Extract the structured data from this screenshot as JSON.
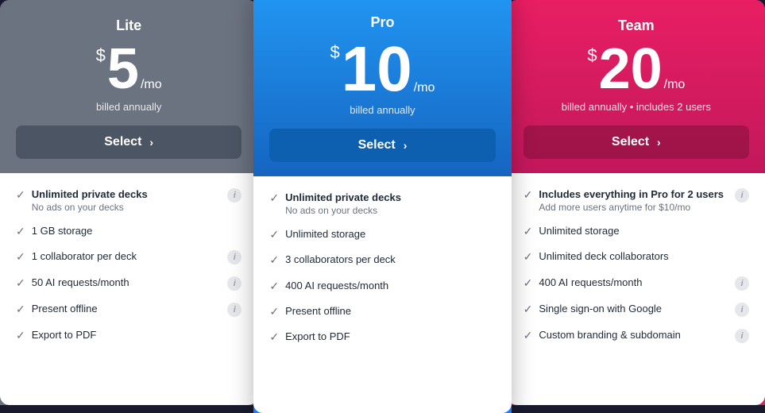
{
  "plans": [
    {
      "id": "lite",
      "name": "Lite",
      "price": "5",
      "period": "/mo",
      "billing": "billed annually",
      "select_label": "Select",
      "features": [
        {
          "text": "Unlimited private decks",
          "sub": "No ads on your decks",
          "bold": true,
          "info": true
        },
        {
          "text": "1 GB storage",
          "bold": false,
          "info": false
        },
        {
          "text": "1 collaborator per deck",
          "bold": false,
          "info": true
        },
        {
          "text": "50 AI requests/month",
          "bold": false,
          "info": true
        },
        {
          "text": "Present offline",
          "bold": false,
          "info": true
        },
        {
          "text": "Export to PDF",
          "bold": false,
          "info": false
        }
      ]
    },
    {
      "id": "pro",
      "name": "Pro",
      "price": "10",
      "period": "/mo",
      "billing": "billed annually",
      "select_label": "Select",
      "features": [
        {
          "text": "Unlimited private decks",
          "sub": "No ads on your decks",
          "bold": true,
          "info": false
        },
        {
          "text": "Unlimited storage",
          "bold": false,
          "info": false
        },
        {
          "text": "3 collaborators per deck",
          "bold": false,
          "info": false
        },
        {
          "text": "400 AI requests/month",
          "bold": false,
          "info": false
        },
        {
          "text": "Present offline",
          "bold": false,
          "info": false
        },
        {
          "text": "Export to PDF",
          "bold": false,
          "info": false
        }
      ]
    },
    {
      "id": "team",
      "name": "Team",
      "price": "20",
      "period": "/mo",
      "billing": "billed annually • includes 2 users",
      "select_label": "Select",
      "features": [
        {
          "text": "Includes everything in Pro for 2 users",
          "sub": "Add more users anytime for $10/mo",
          "bold": true,
          "info": true
        },
        {
          "text": "Unlimited storage",
          "bold": false,
          "info": false
        },
        {
          "text": "Unlimited deck collaborators",
          "bold": false,
          "info": false
        },
        {
          "text": "400 AI requests/month",
          "bold": false,
          "info": true
        },
        {
          "text": "Single sign-on with Google",
          "bold": false,
          "info": true
        },
        {
          "text": "Custom branding & subdomain",
          "bold": false,
          "info": true
        }
      ]
    }
  ]
}
